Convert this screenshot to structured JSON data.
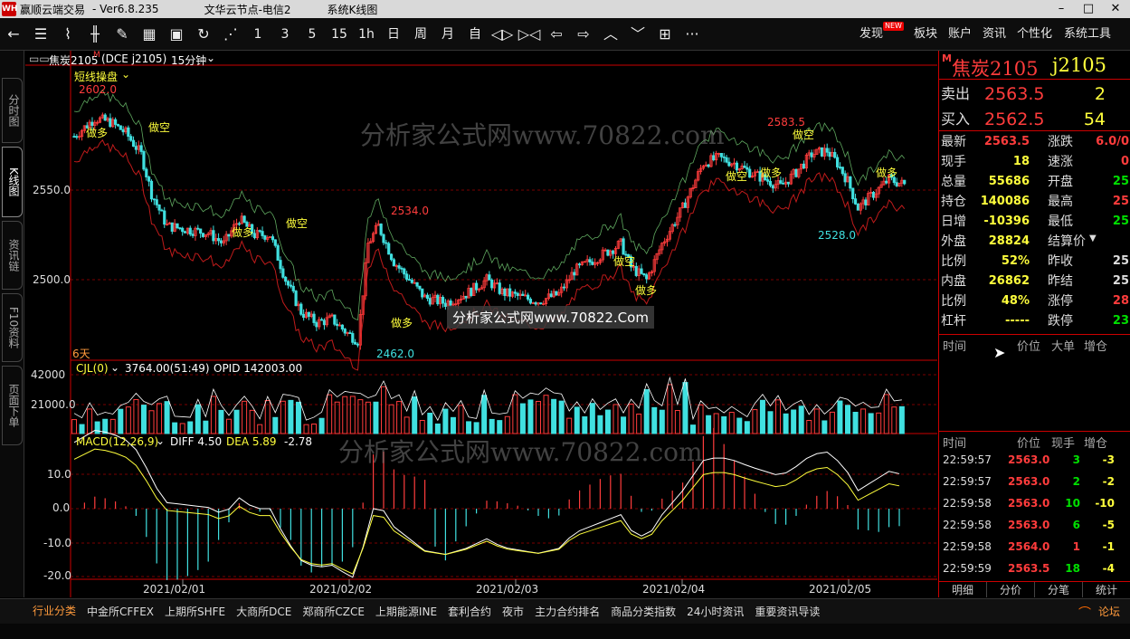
{
  "titlebar": {
    "app": "赢顺云端交易",
    "version": "-  Ver6.8.235",
    "server": "文华云节点-电信2",
    "page": "系统K线图",
    "logo_text": "WH"
  },
  "toolbar": {
    "periods": [
      "1",
      "3",
      "5",
      "15",
      "1h",
      "日",
      "周",
      "月",
      "自"
    ],
    "menus": [
      "发现",
      "板块",
      "账户",
      "资讯",
      "个性化",
      "系统工具"
    ],
    "new_badge": "NEW",
    "more": "···"
  },
  "lefttabs": [
    "分时图",
    "K线图",
    "资讯链",
    "F10资料",
    "页面下单"
  ],
  "chart": {
    "header_symbol": "焦炭2105",
    "header_m": "M",
    "header_code": "(DCE j2105)",
    "header_period": "15分钟",
    "formula": "短线操盘",
    "days_label": "6天",
    "price_axis": [
      "2550.0",
      "2500.0"
    ],
    "price_axis_values": [
      2550,
      2500
    ],
    "price_labels": {
      "p2602": "2602.0",
      "p2534": "2534.0",
      "p2583": "2583.5",
      "p2528": "2528.0",
      "p2462": "2462.0"
    },
    "signal_long": "做多",
    "signal_short": "做空",
    "vol_header": "CJL(0)",
    "vol_value": "3764.00(51:49)",
    "vol_oi": "OPID 142003.00",
    "vol_axis": [
      "42000",
      "21000.0"
    ],
    "macd_header": "MACD(12,26,9)",
    "macd_diff": "DIFF 4.50",
    "macd_dea": "DEA 5.89",
    "macd_macd": "-2.78",
    "macd_axis": [
      "10.0",
      "0.0",
      "-10.0",
      "-20.0"
    ],
    "dates": [
      "2021/02/01",
      "2021/02/02",
      "2021/02/03",
      "2021/02/04",
      "2021/02/05"
    ],
    "watermark": "分析家公式网www.70822.com",
    "watermark_box": "分析家公式网www.70822.Com",
    "colors": {
      "up": "#ff3c3c",
      "down": "#40e0e0",
      "diff": "#ffffff",
      "dea": "#ffff3c"
    }
  },
  "right": {
    "m": "M",
    "name": "焦炭2105",
    "code": "j2105",
    "sell_label": "卖出",
    "sell_price": "2563.5",
    "sell_vol": "2",
    "buy_label": "买入",
    "buy_price": "2562.5",
    "buy_vol": "54",
    "stats_left": [
      {
        "label": "最新",
        "value": "2563.5",
        "cls": "red"
      },
      {
        "label": "现手",
        "value": "18",
        "cls": "yel"
      },
      {
        "label": "总量",
        "value": "55686",
        "cls": "yel"
      },
      {
        "label": "持仓",
        "value": "140086",
        "cls": "yel"
      },
      {
        "label": "日增",
        "value": "-10396",
        "cls": "yel"
      },
      {
        "label": "外盘",
        "value": "28824",
        "cls": "yel"
      },
      {
        "label": "比例",
        "value": "52%",
        "cls": "yel"
      },
      {
        "label": "内盘",
        "value": "26862",
        "cls": "yel"
      },
      {
        "label": "比例",
        "value": "48%",
        "cls": "yel"
      },
      {
        "label": "杠杆",
        "value": "-----",
        "cls": "yel"
      }
    ],
    "stats_right": [
      {
        "label": "涨跌",
        "value": "6.0/0",
        "cls": "red"
      },
      {
        "label": "速涨",
        "value": "0",
        "cls": "red"
      },
      {
        "label": "开盘",
        "value": "25",
        "cls": "grn"
      },
      {
        "label": "最高",
        "value": "25",
        "cls": "red"
      },
      {
        "label": "最低",
        "value": "25",
        "cls": "grn"
      },
      {
        "label": "结算价",
        "value": "",
        "cls": "wht"
      },
      {
        "label": "昨收",
        "value": "25",
        "cls": "wht"
      },
      {
        "label": "昨结",
        "value": "25",
        "cls": "wht"
      },
      {
        "label": "涨停",
        "value": "28",
        "cls": "red"
      },
      {
        "label": "跌停",
        "value": "23",
        "cls": "grn"
      }
    ],
    "bigorder_headers": [
      "时间",
      "价位",
      "大单",
      "增仓"
    ],
    "tick_headers": [
      "时间",
      "价位",
      "现手",
      "增仓"
    ],
    "ticks": [
      {
        "time": "22:59:57",
        "price": "2563.0",
        "vol": "3",
        "oi": "-3",
        "vcls": "grn",
        "ocls": "yel"
      },
      {
        "time": "22:59:57",
        "price": "2563.0",
        "vol": "2",
        "oi": "-2",
        "vcls": "grn",
        "ocls": "yel"
      },
      {
        "time": "22:59:58",
        "price": "2563.0",
        "vol": "10",
        "oi": "-10",
        "vcls": "grn",
        "ocls": "yel"
      },
      {
        "time": "22:59:58",
        "price": "2563.0",
        "vol": "6",
        "oi": "-5",
        "vcls": "grn",
        "ocls": "yel"
      },
      {
        "time": "22:59:58",
        "price": "2564.0",
        "vol": "1",
        "oi": "-1",
        "vcls": "red",
        "ocls": "yel"
      },
      {
        "time": "22:59:59",
        "price": "2563.5",
        "vol": "18",
        "oi": "-4",
        "vcls": "grn",
        "ocls": "yel"
      }
    ],
    "bottom_tabs": [
      "明细",
      "分价",
      "分笔",
      "统计"
    ]
  },
  "bottombar": [
    "行业分类",
    "中金所CFFEX",
    "上期所SHFE",
    "大商所DCE",
    "郑商所CZCE",
    "上期能源INE",
    "套利合约",
    "夜市",
    "主力合约排名",
    "商品分类指数",
    "24小时资讯",
    "重要资讯导读"
  ],
  "bottom_right": "论坛"
}
